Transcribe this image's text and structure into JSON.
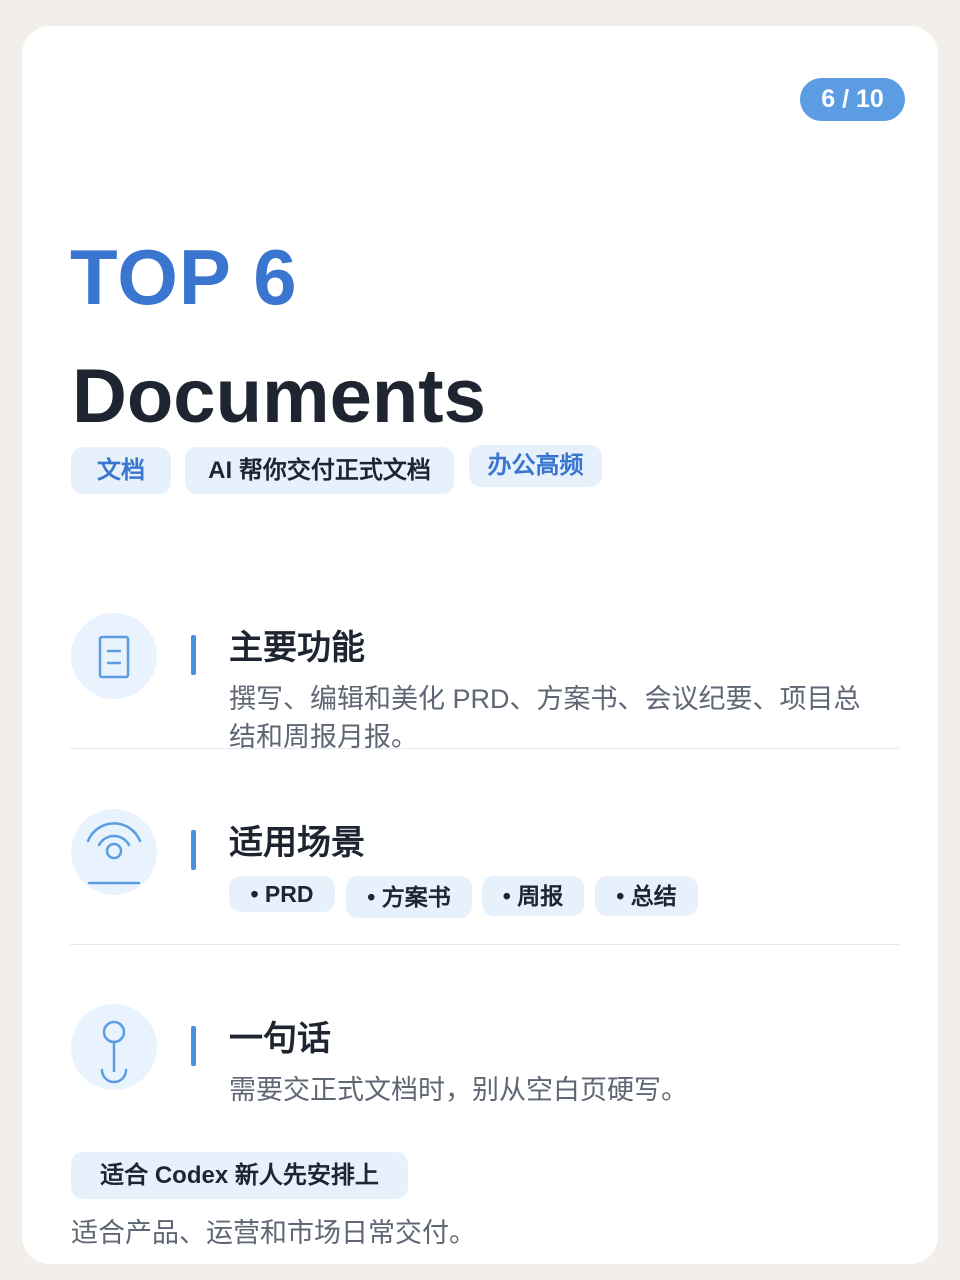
{
  "page_indicator": "6 / 10",
  "top_label": "TOP 6",
  "title": "Documents",
  "tags": [
    "文档",
    "AI 帮你交付正式文档",
    "办公高频"
  ],
  "sections": [
    {
      "icon": "document-icon",
      "title": "主要功能",
      "text_line1": "撰写、编辑和美化 PRD、方案书、会议纪要、项目总",
      "text_line2": "结和周报月报。"
    },
    {
      "icon": "scene-wave-icon",
      "title": "适用场景",
      "chips": [
        "• PRD",
        "• 方案书",
        "• 周报",
        "• 总结"
      ]
    },
    {
      "icon": "pin-icon",
      "title": "一句话",
      "text_line1": "需要交正式文档时，别从空白页硬写。"
    }
  ],
  "footer": {
    "tag": "适合 Codex 新人先安排上",
    "text": "适合产品、运营和市场日常交付。"
  },
  "colors": {
    "accent": "#3a76cf",
    "badge": "#5b9ce2",
    "tag_bg": "#e6f1fc",
    "text_dark": "#1f2530",
    "text_muted": "#5f6774",
    "background": "#f2efea"
  }
}
